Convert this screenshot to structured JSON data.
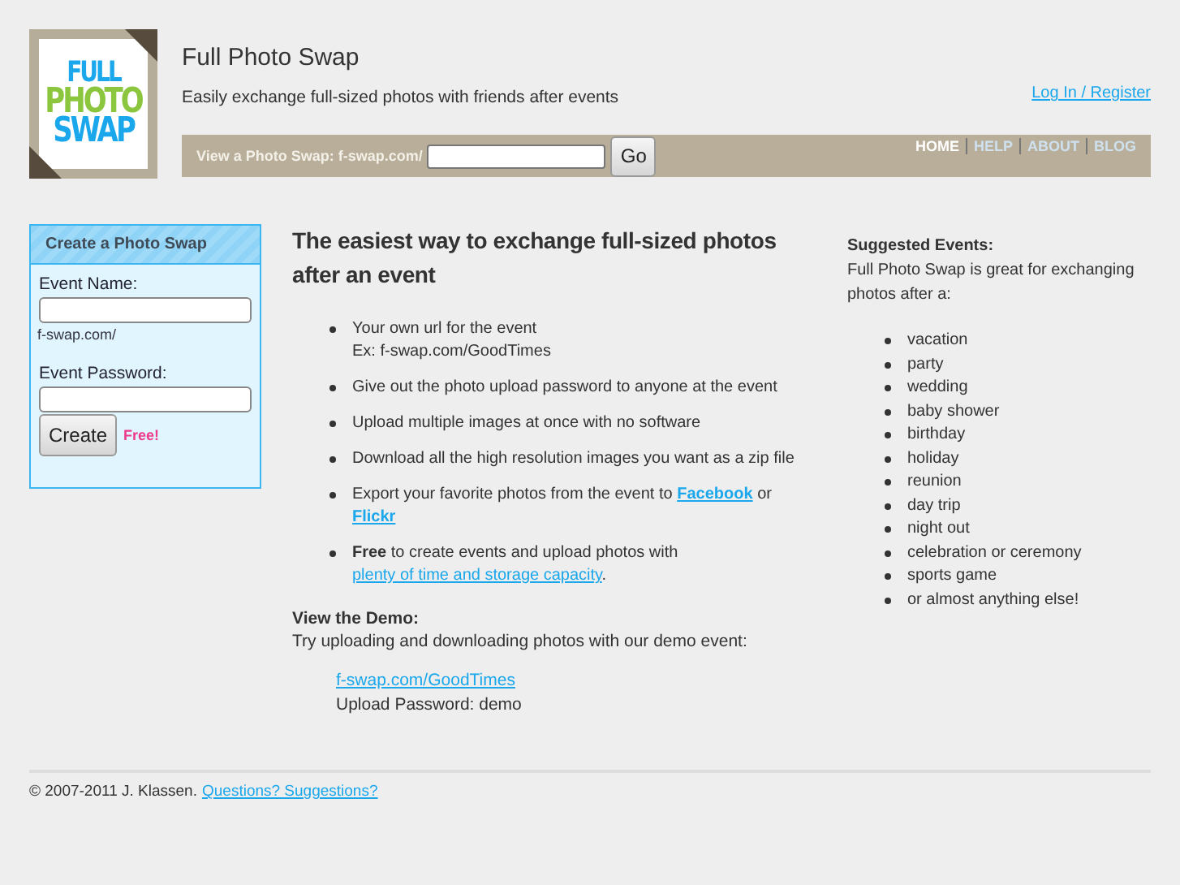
{
  "logo": {
    "lines": [
      "FULL",
      "PHOTO",
      "SWAP"
    ]
  },
  "site": {
    "title": "Full Photo Swap",
    "tagline": "Easily exchange full-sized photos with friends after events",
    "login": "Log In / Register"
  },
  "view_bar": {
    "label": "View a Photo Swap: f-swap.com/",
    "button": "Go"
  },
  "nav": [
    {
      "label": "HOME",
      "selected": true
    },
    {
      "label": "HELP",
      "selected": false
    },
    {
      "label": "ABOUT",
      "selected": false
    },
    {
      "label": "BLOG",
      "selected": false
    }
  ],
  "create_panel": {
    "title": "Create a Photo Swap",
    "name_label": "Event Name:",
    "url_hint": "f-swap.com/",
    "password_label": "Event Password:",
    "button": "Create",
    "badge": "Free!"
  },
  "main": {
    "heading": "The easiest way to exchange full-sized photos after an event",
    "features": [
      [
        {
          "kind": "text",
          "text": "Your own url for the event"
        },
        {
          "kind": "break"
        },
        {
          "kind": "text",
          "text": "Ex: f-swap.com/GoodTimes"
        }
      ],
      [
        {
          "kind": "text",
          "text": "Give out the photo upload password to anyone at the event"
        }
      ],
      [
        {
          "kind": "text",
          "text": "Upload multiple images at once with no software"
        }
      ],
      [
        {
          "kind": "text",
          "text": "Download all the high resolution images you want as a zip file"
        }
      ],
      [
        {
          "kind": "text",
          "text": "Export your favorite photos from the event to "
        },
        {
          "kind": "boldlink",
          "text": "Facebook"
        },
        {
          "kind": "text",
          "text": " or "
        },
        {
          "kind": "boldlink",
          "text": "Flickr"
        }
      ],
      [
        {
          "kind": "bold",
          "text": "Free"
        },
        {
          "kind": "text",
          "text": " to create events and upload photos with"
        },
        {
          "kind": "break"
        },
        {
          "kind": "link",
          "text": "plenty of time and storage capacity"
        },
        {
          "kind": "text",
          "text": "."
        }
      ]
    ],
    "demo_title": "View the Demo:",
    "demo_text": "Try uploading and downloading photos with our demo event:",
    "demo_link": "f-swap.com/GoodTimes",
    "demo_password": "Upload Password: demo"
  },
  "suggested": {
    "title": "Suggested Events:",
    "intro": "Full Photo Swap is great for exchanging photos after a:",
    "items": [
      "vacation",
      "party",
      "wedding",
      "baby shower",
      "birthday",
      "holiday",
      "reunion",
      "day trip",
      "night out",
      "celebration or ceremony",
      "sports game",
      "or almost anything else!"
    ]
  },
  "footer": {
    "copyright": "© 2007-2011 J. Klassen.",
    "link": "Questions? Suggestions?"
  }
}
